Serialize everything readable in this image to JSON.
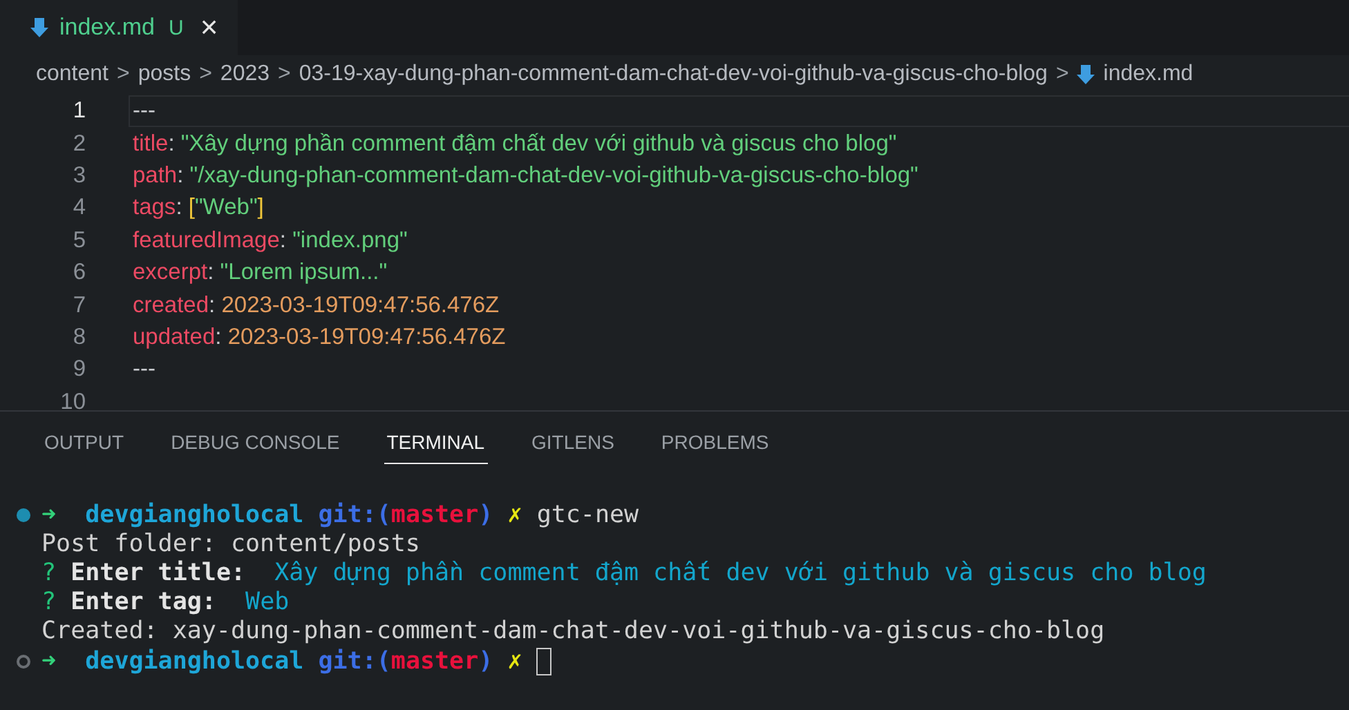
{
  "tabs": [
    {
      "label": "index.md",
      "status": "U",
      "close": "×",
      "selected": true
    }
  ],
  "breadcrumb": {
    "items": [
      "content",
      "posts",
      "2023",
      "03-19-xay-dung-phan-comment-dam-chat-dev-voi-github-va-giscus-cho-blog",
      "index.md"
    ],
    "separator": ">"
  },
  "editor": {
    "lines": [
      {
        "number": "1",
        "current": true,
        "tokens": [
          {
            "kind": "punct",
            "text": "---"
          }
        ]
      },
      {
        "number": "2",
        "current": false,
        "tokens": [
          {
            "kind": "key",
            "text": "title"
          },
          {
            "kind": "punct",
            "text": ": "
          },
          {
            "kind": "string",
            "text": "\"Xây dựng phần comment đậm chất dev với github và giscus cho blog\""
          }
        ]
      },
      {
        "number": "3",
        "current": false,
        "tokens": [
          {
            "kind": "key",
            "text": "path"
          },
          {
            "kind": "punct",
            "text": ": "
          },
          {
            "kind": "string",
            "text": "\"/xay-dung-phan-comment-dam-chat-dev-voi-github-va-giscus-cho-blog\""
          }
        ]
      },
      {
        "number": "4",
        "current": false,
        "tokens": [
          {
            "kind": "key",
            "text": "tags"
          },
          {
            "kind": "punct",
            "text": ": "
          },
          {
            "kind": "bracket",
            "text": "["
          },
          {
            "kind": "string",
            "text": "\"Web\""
          },
          {
            "kind": "bracket",
            "text": "]"
          }
        ]
      },
      {
        "number": "5",
        "current": false,
        "tokens": [
          {
            "kind": "key",
            "text": "featuredImage"
          },
          {
            "kind": "punct",
            "text": ": "
          },
          {
            "kind": "string",
            "text": "\"index.png\""
          }
        ]
      },
      {
        "number": "6",
        "current": false,
        "tokens": [
          {
            "kind": "key",
            "text": "excerpt"
          },
          {
            "kind": "punct",
            "text": ": "
          },
          {
            "kind": "string",
            "text": "\"Lorem ipsum...\""
          }
        ]
      },
      {
        "number": "7",
        "current": false,
        "tokens": [
          {
            "kind": "key",
            "text": "created"
          },
          {
            "kind": "punct",
            "text": ": "
          },
          {
            "kind": "date",
            "text": "2023-03-19T09:47:56.476Z"
          }
        ]
      },
      {
        "number": "8",
        "current": false,
        "tokens": [
          {
            "kind": "key",
            "text": "updated"
          },
          {
            "kind": "punct",
            "text": ": "
          },
          {
            "kind": "date",
            "text": "2023-03-19T09:47:56.476Z"
          }
        ]
      },
      {
        "number": "9",
        "current": false,
        "tokens": [
          {
            "kind": "punct",
            "text": "---"
          }
        ]
      },
      {
        "number": "10",
        "current": false
      }
    ]
  },
  "panel_tabs": [
    {
      "label": "OUTPUT",
      "selected": false
    },
    {
      "label": "DEBUG CONSOLE",
      "selected": false
    },
    {
      "label": "TERMINAL",
      "selected": true
    },
    {
      "label": "GITLENS",
      "selected": false
    },
    {
      "label": "PROBLEMS",
      "selected": false
    }
  ],
  "terminal": {
    "lines": [
      {
        "kind": "prompt",
        "active": true,
        "cursor": false,
        "segments": [
          {
            "kind": "arrow",
            "text": "➜"
          },
          {
            "kind": "user",
            "text": "devgiangholocal"
          },
          {
            "kind": "git",
            "text": "git:("
          },
          {
            "kind": "branch",
            "text": "master"
          },
          {
            "kind": "git",
            "text": ")"
          },
          {
            "kind": "mark",
            "text": "✗"
          },
          {
            "kind": "plain",
            "text": "gtc-new"
          }
        ]
      },
      {
        "kind": "output",
        "segments": [
          {
            "kind": "plain",
            "text": "Post folder: content/posts"
          }
        ]
      },
      {
        "kind": "output",
        "segments": [
          {
            "kind": "question",
            "text": "?"
          },
          {
            "kind": "bold",
            "text": "Enter title:"
          },
          {
            "kind": "answer",
            "text": " Xây dựng phần comment đậm chất dev với github và giscus cho blog"
          }
        ]
      },
      {
        "kind": "output",
        "segments": [
          {
            "kind": "question",
            "text": "?"
          },
          {
            "kind": "bold",
            "text": "Enter tag:"
          },
          {
            "kind": "answer",
            "text": " Web"
          }
        ]
      },
      {
        "kind": "output",
        "segments": [
          {
            "kind": "plain",
            "text": "Created: xay-dung-phan-comment-dam-chat-dev-voi-github-va-giscus-cho-blog"
          }
        ]
      },
      {
        "kind": "prompt",
        "active": false,
        "cursor": true,
        "segments": [
          {
            "kind": "arrow",
            "text": "➜"
          },
          {
            "kind": "user",
            "text": "devgiangholocal"
          },
          {
            "kind": "git",
            "text": "git:("
          },
          {
            "kind": "branch",
            "text": "master"
          },
          {
            "kind": "git",
            "text": ")"
          },
          {
            "kind": "mark",
            "text": "✗"
          }
        ]
      }
    ]
  }
}
